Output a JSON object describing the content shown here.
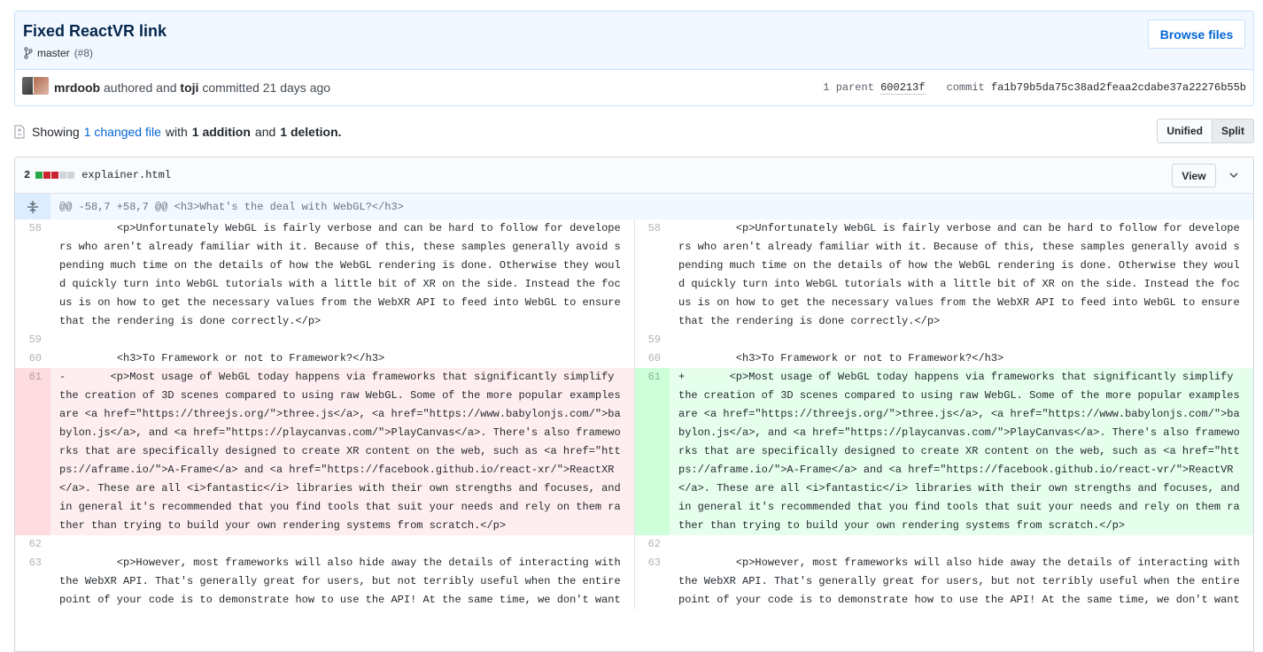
{
  "commit": {
    "title": "Fixed ReactVR link",
    "branch": "master",
    "pr": "(#8)",
    "browse_label": "Browse files",
    "author": "mrdoob",
    "authored_word": "authored and",
    "committer": "toji",
    "committed_text": "committed 21 days ago",
    "parent_label": "1 parent",
    "parent_sha": "600213f",
    "commit_label": "commit",
    "commit_sha": "fa1b79b5da75c38ad2feaa2cdabe37a22276b55b"
  },
  "summary": {
    "showing": "Showing",
    "changed_files": "1 changed file",
    "with": "with",
    "additions": "1 addition",
    "and": "and",
    "deletions": "1 deletion."
  },
  "view_toggle": {
    "unified": "Unified",
    "split": "Split",
    "selected": "Split"
  },
  "file": {
    "change_count": "2",
    "name": "explainer.html",
    "view_label": "View",
    "hunk_header": "@@ -58,7 +58,7 @@ <h3>What's the deal with WebGL?</h3>"
  },
  "colors": {
    "deletion": "#ffeef0",
    "addition": "#e6ffed",
    "link": "#0366d6"
  },
  "left_lines": [
    {
      "num": "58",
      "type": "context",
      "marker": "",
      "text": "        <p>Unfortunately WebGL is fairly verbose and can be hard to follow for developers who aren't already familiar with it. Because of this, these samples generally avoid spending much time on the details of how the WebGL rendering is done. Otherwise they would quickly turn into WebGL tutorials with a little bit of XR on the side. Instead the focus is on how to get the necessary values from the WebXR API to feed into WebGL to ensure that the rendering is done correctly.</p>"
    },
    {
      "num": "59",
      "type": "context",
      "marker": "",
      "text": ""
    },
    {
      "num": "60",
      "type": "context",
      "marker": "",
      "text": "        <h3>To Framework or not to Framework?</h3>"
    },
    {
      "num": "61",
      "type": "del",
      "marker": "-",
      "text": "       <p>Most usage of WebGL today happens via frameworks that significantly simplify the creation of 3D scenes compared to using raw WebGL. Some of the more popular examples are <a href=\"https://threejs.org/\">three.js</a>, <a href=\"https://www.babylonjs.com/\">babylon.js</a>, and <a href=\"https://playcanvas.com/\">PlayCanvas</a>. There's also frameworks that are specifically designed to create XR content on the web, such as <a href=\"https://aframe.io/\">A-Frame</a> and <a href=\"https://facebook.github.io/react-xr/\">ReactXR</a>. These are all <i>fantastic</i> libraries with their own strengths and focuses, and in general it's recommended that you find tools that suit your needs and rely on them rather than trying to build your own rendering systems from scratch.</p>"
    },
    {
      "num": "62",
      "type": "context",
      "marker": "",
      "text": ""
    },
    {
      "num": "63",
      "type": "context",
      "marker": "",
      "text": "        <p>However, most frameworks will also hide away the details of interacting with the WebXR API. That's generally great for users, but not terribly useful when the entire point of your code is to demonstrate how to use the API! At the same time, we don't want"
    }
  ],
  "right_lines": [
    {
      "num": "58",
      "type": "context",
      "marker": "",
      "text": "        <p>Unfortunately WebGL is fairly verbose and can be hard to follow for developers who aren't already familiar with it. Because of this, these samples generally avoid spending much time on the details of how the WebGL rendering is done. Otherwise they would quickly turn into WebGL tutorials with a little bit of XR on the side. Instead the focus is on how to get the necessary values from the WebXR API to feed into WebGL to ensure that the rendering is done correctly.</p>"
    },
    {
      "num": "59",
      "type": "context",
      "marker": "",
      "text": ""
    },
    {
      "num": "60",
      "type": "context",
      "marker": "",
      "text": "        <h3>To Framework or not to Framework?</h3>"
    },
    {
      "num": "61",
      "type": "add",
      "marker": "+",
      "text": "       <p>Most usage of WebGL today happens via frameworks that significantly simplify the creation of 3D scenes compared to using raw WebGL. Some of the more popular examples are <a href=\"https://threejs.org/\">three.js</a>, <a href=\"https://www.babylonjs.com/\">babylon.js</a>, and <a href=\"https://playcanvas.com/\">PlayCanvas</a>. There's also frameworks that are specifically designed to create XR content on the web, such as <a href=\"https://aframe.io/\">A-Frame</a> and <a href=\"https://facebook.github.io/react-vr/\">ReactVR</a>. These are all <i>fantastic</i> libraries with their own strengths and focuses, and in general it's recommended that you find tools that suit your needs and rely on them rather than trying to build your own rendering systems from scratch.</p>"
    },
    {
      "num": "62",
      "type": "context",
      "marker": "",
      "text": ""
    },
    {
      "num": "63",
      "type": "context",
      "marker": "",
      "text": "        <p>However, most frameworks will also hide away the details of interacting with the WebXR API. That's generally great for users, but not terribly useful when the entire point of your code is to demonstrate how to use the API! At the same time, we don't want"
    }
  ]
}
